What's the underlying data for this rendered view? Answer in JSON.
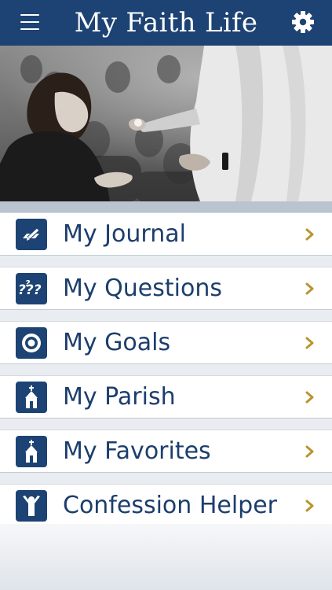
{
  "header": {
    "title": "My Faith Life",
    "menu_icon": "hamburger-menu-icon",
    "settings_icon": "gear-icon"
  },
  "hero": {
    "image": "grayscale photo of a priest giving communion to a woman"
  },
  "menu": {
    "items": [
      {
        "label": "My Journal",
        "icon": "journal-pen-icon"
      },
      {
        "label": "My Questions",
        "icon": "question-marks-icon"
      },
      {
        "label": "My Goals",
        "icon": "target-icon"
      },
      {
        "label": "My Parish",
        "icon": "church-icon"
      },
      {
        "label": "My Favorites",
        "icon": "church-icon"
      },
      {
        "label": "Confession Helper",
        "icon": "raised-arms-person-icon"
      }
    ]
  },
  "colors": {
    "header": "#1c4373",
    "label": "#1c3e6c",
    "chevron": "#b8952e",
    "band": "#b9c4d0"
  }
}
